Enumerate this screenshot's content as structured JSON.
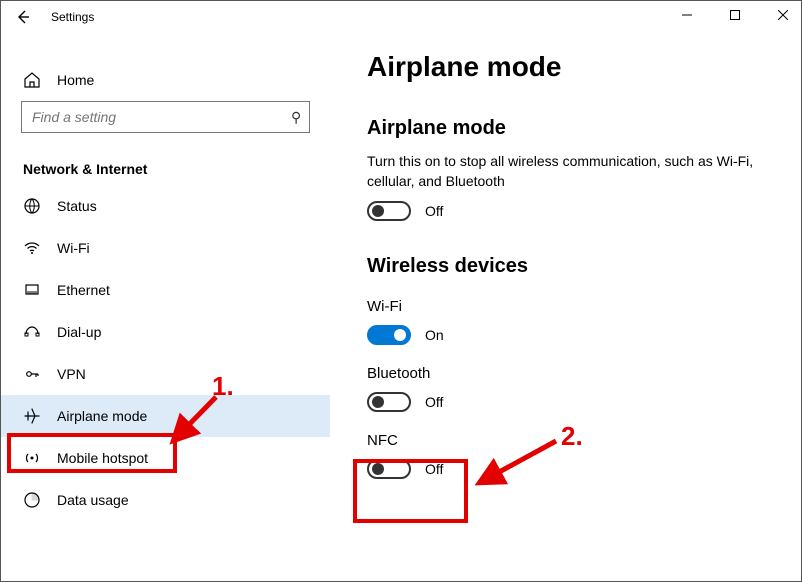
{
  "window": {
    "title": "Settings"
  },
  "home": {
    "label": "Home"
  },
  "search": {
    "placeholder": "Find a setting"
  },
  "category_header": "Network & Internet",
  "sidebar": {
    "items": [
      {
        "label": "Status",
        "icon": "globe-icon",
        "selected": false
      },
      {
        "label": "Wi-Fi",
        "icon": "wifi-icon",
        "selected": false
      },
      {
        "label": "Ethernet",
        "icon": "ethernet-icon",
        "selected": false
      },
      {
        "label": "Dial-up",
        "icon": "dialup-icon",
        "selected": false
      },
      {
        "label": "VPN",
        "icon": "vpn-icon",
        "selected": false
      },
      {
        "label": "Airplane mode",
        "icon": "airplane-icon",
        "selected": true
      },
      {
        "label": "Mobile hotspot",
        "icon": "hotspot-icon",
        "selected": false
      },
      {
        "label": "Data usage",
        "icon": "datausage-icon",
        "selected": false
      }
    ]
  },
  "page": {
    "title": "Airplane mode",
    "airplane_section": {
      "header": "Airplane mode",
      "desc": "Turn this on to stop all wireless communication, such as Wi-Fi, cellular, and Bluetooth",
      "toggle": {
        "on": false,
        "state_label": "Off"
      }
    },
    "wireless_section": {
      "header": "Wireless devices",
      "devices": [
        {
          "name": "Wi-Fi",
          "on": true,
          "state_label": "On"
        },
        {
          "name": "Bluetooth",
          "on": false,
          "state_label": "Off"
        },
        {
          "name": "NFC",
          "on": false,
          "state_label": "Off"
        }
      ]
    }
  },
  "annotations": {
    "label1": "1.",
    "label2": "2."
  }
}
